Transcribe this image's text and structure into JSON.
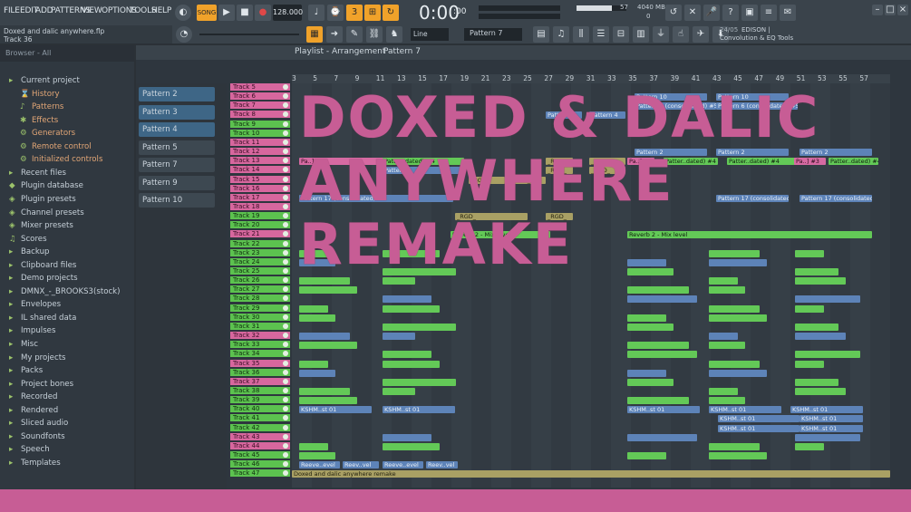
{
  "menu": [
    "FILE",
    "EDIT",
    "ADD",
    "PATTERNS",
    "VIEW",
    "OPTIONS",
    "TOOLS",
    "HELP"
  ],
  "transport": {
    "mode": "SONG",
    "tempo": "128.000",
    "time": "0:00",
    "time_sub": ":00",
    "cpu": "57",
    "ram": "4040 MB",
    "voices": "0"
  },
  "song": {
    "file": "Doxed and dalic anywhere.flp",
    "track": "Track 36"
  },
  "snap": "Line",
  "pattern_selector": "Pattern 7",
  "plugin_hint": {
    "date": "24/05",
    "name": "EDISON |",
    "desc": "Convolution & EQ Tools"
  },
  "browser": {
    "header": "Browser - All",
    "items": [
      {
        "label": "Current project",
        "icon": "folder-icon",
        "sub": false
      },
      {
        "label": "History",
        "icon": "history-icon",
        "sub": true
      },
      {
        "label": "Patterns",
        "icon": "patterns-icon",
        "sub": true
      },
      {
        "label": "Effects",
        "icon": "effects-icon",
        "sub": true
      },
      {
        "label": "Generators",
        "icon": "generators-icon",
        "sub": true
      },
      {
        "label": "Remote control",
        "icon": "remote-icon",
        "sub": true
      },
      {
        "label": "Initialized controls",
        "icon": "controls-icon",
        "sub": true
      },
      {
        "label": "Recent files",
        "icon": "folder-icon",
        "sub": false
      },
      {
        "label": "Plugin database",
        "icon": "plugin-icon",
        "sub": false
      },
      {
        "label": "Plugin presets",
        "icon": "preset-icon",
        "sub": false
      },
      {
        "label": "Channel presets",
        "icon": "preset-icon",
        "sub": false
      },
      {
        "label": "Mixer presets",
        "icon": "preset-icon",
        "sub": false
      },
      {
        "label": "Scores",
        "icon": "score-icon",
        "sub": false
      },
      {
        "label": "Backup",
        "icon": "folder-icon",
        "sub": false
      },
      {
        "label": "Clipboard files",
        "icon": "folder-icon",
        "sub": false
      },
      {
        "label": "Demo projects",
        "icon": "folder-icon",
        "sub": false
      },
      {
        "label": "DMNX_-_BROOKS3(stock)",
        "icon": "folder-icon",
        "sub": false
      },
      {
        "label": "Envelopes",
        "icon": "folder-icon",
        "sub": false
      },
      {
        "label": "IL shared data",
        "icon": "folder-icon",
        "sub": false
      },
      {
        "label": "Impulses",
        "icon": "folder-icon",
        "sub": false
      },
      {
        "label": "Misc",
        "icon": "folder-icon",
        "sub": false
      },
      {
        "label": "My projects",
        "icon": "folder-icon",
        "sub": false
      },
      {
        "label": "Packs",
        "icon": "folder-icon",
        "sub": false
      },
      {
        "label": "Project bones",
        "icon": "folder-icon",
        "sub": false
      },
      {
        "label": "Recorded",
        "icon": "folder-icon",
        "sub": false
      },
      {
        "label": "Rendered",
        "icon": "folder-icon",
        "sub": false
      },
      {
        "label": "Sliced audio",
        "icon": "folder-icon",
        "sub": false
      },
      {
        "label": "Soundfonts",
        "icon": "folder-icon",
        "sub": false
      },
      {
        "label": "Speech",
        "icon": "folder-icon",
        "sub": false
      },
      {
        "label": "Templates",
        "icon": "folder-icon",
        "sub": false
      }
    ]
  },
  "playlist": {
    "title": "Playlist - Arrangement",
    "pattern": "Pattern 7"
  },
  "patterns": [
    "Pattern 2",
    "Pattern 3",
    "Pattern 4",
    "Pattern 5",
    "Pattern 7",
    "Pattern 9",
    "Pattern 10"
  ],
  "ruler": [
    "3",
    "5",
    "7",
    "9",
    "11",
    "13",
    "15",
    "17",
    "19",
    "21",
    "23",
    "25",
    "27",
    "29",
    "31",
    "33",
    "35",
    "37",
    "39",
    "41",
    "43",
    "45",
    "47",
    "49",
    "51",
    "53",
    "55",
    "57"
  ],
  "tracks": [
    "Track 5",
    "Track 6",
    "Track 7",
    "Track 8",
    "Track 9",
    "Track 10",
    "Track 11",
    "Track 12",
    "Track 13",
    "Track 14",
    "Track 15",
    "Track 16",
    "Track 17",
    "Track 18",
    "Track 19",
    "Track 20",
    "Track 21",
    "Track 22",
    "Track 23",
    "Track 24",
    "Track 25",
    "Track 26",
    "Track 27",
    "Track 28",
    "Track 29",
    "Track 30",
    "Track 31",
    "Track 32",
    "Track 33",
    "Track 34",
    "Track 35",
    "Track 36",
    "Track 37",
    "Track 38",
    "Track 39",
    "Track 40",
    "Track 41",
    "Track 42",
    "Track 43",
    "Track 44",
    "Track 45",
    "Track 46",
    "Track 47"
  ],
  "clips": {
    "pattern10": "Pattern 10",
    "pattern6": "Pattern 6 (consolidated) #5",
    "pattern4": "Pattern 4",
    "pattern2": "Pattern 2",
    "patdated": "Patter..dated) #4",
    "pa3": "Pa..] #3",
    "rgd": "_RGD_",
    "pattern17": "Pattern 17 (consolidated) #3",
    "reverb": "Reverb 2 - Mix level",
    "ksh": "KSHM..st 01",
    "reev": "Reeve..evel",
    "reev2": "Reev..vel",
    "audio": "Doxed and dalic anywhere remake"
  },
  "overlay": [
    "DOXED & DALIC",
    "ANYWHERE",
    "REMAKE"
  ],
  "colors": {
    "accent": "#f0a22a",
    "track_green": "#5cc24f",
    "track_pink": "#d7679e",
    "overlay": "#c75d95"
  }
}
